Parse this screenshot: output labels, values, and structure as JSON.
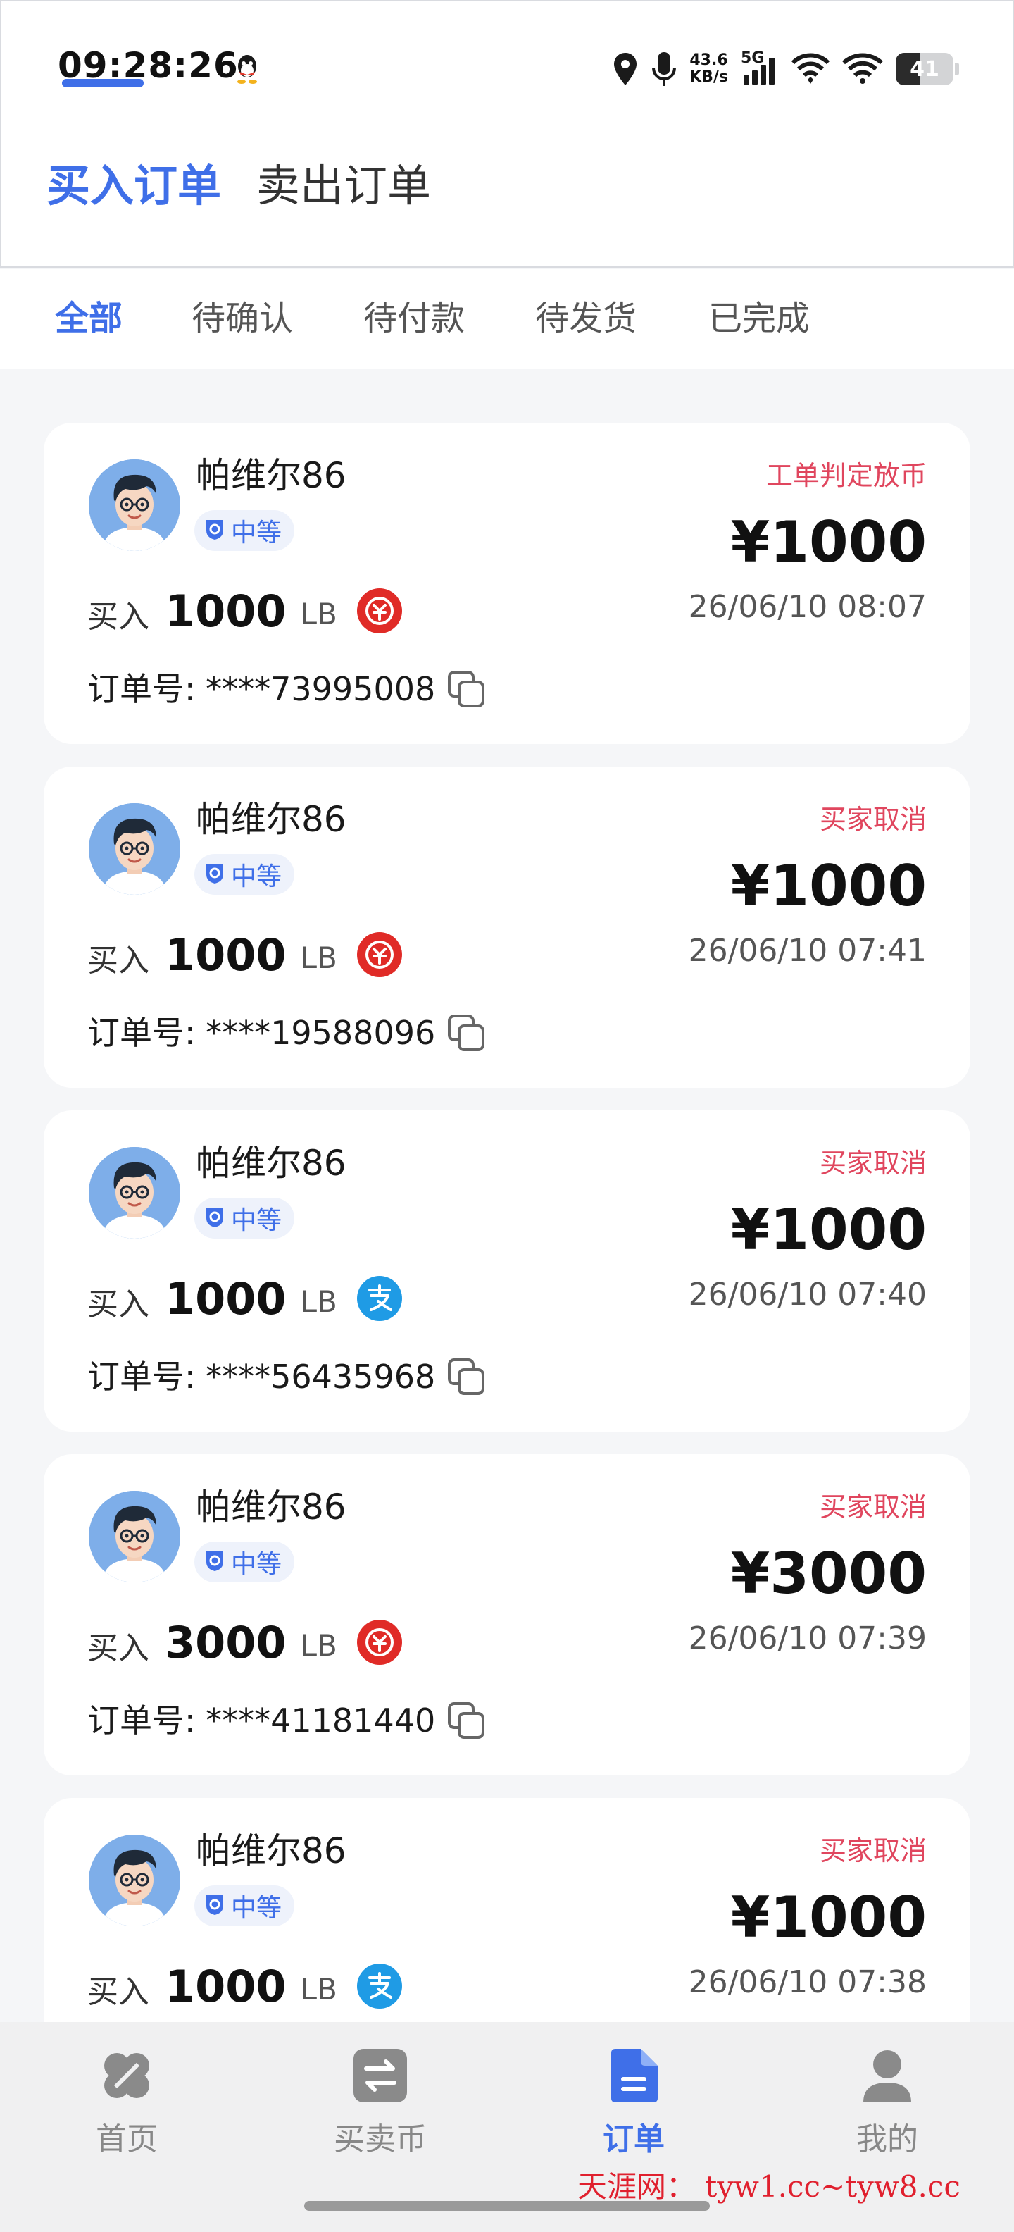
{
  "status_bar": {
    "time": "09:28:26",
    "net_speed_value": "43.6",
    "net_speed_unit": "KB/s",
    "network_type": "5G",
    "battery_level": 41,
    "icons": [
      "qq-icon",
      "location-icon",
      "microphone-icon",
      "cell-signal-icon",
      "wifi-icon",
      "wifi-icon",
      "battery-icon"
    ]
  },
  "main_tabs": [
    {
      "label": "买入订单",
      "active": true
    },
    {
      "label": "卖出订单",
      "active": false
    }
  ],
  "filter_tabs": [
    {
      "label": "全部",
      "active": true
    },
    {
      "label": "待确认",
      "active": false
    },
    {
      "label": "待付款",
      "active": false
    },
    {
      "label": "待发货",
      "active": false
    },
    {
      "label": "已完成",
      "active": false
    }
  ],
  "orders": [
    {
      "username": "帕维尔86",
      "level": "中等",
      "status": "工单判定放币",
      "price": "¥1000",
      "buy_label": "买入",
      "amount": "1000",
      "unit": "LB",
      "payment": "digital-rmb-icon",
      "date": "26/06/10 08:07",
      "order_label": "订单号: ****73995008"
    },
    {
      "username": "帕维尔86",
      "level": "中等",
      "status": "买家取消",
      "price": "¥1000",
      "buy_label": "买入",
      "amount": "1000",
      "unit": "LB",
      "payment": "digital-rmb-icon",
      "date": "26/06/10 07:41",
      "order_label": "订单号: ****19588096"
    },
    {
      "username": "帕维尔86",
      "level": "中等",
      "status": "买家取消",
      "price": "¥1000",
      "buy_label": "买入",
      "amount": "1000",
      "unit": "LB",
      "payment": "alipay-icon",
      "date": "26/06/10 07:40",
      "order_label": "订单号: ****56435968"
    },
    {
      "username": "帕维尔86",
      "level": "中等",
      "status": "买家取消",
      "price": "¥3000",
      "buy_label": "买入",
      "amount": "3000",
      "unit": "LB",
      "payment": "digital-rmb-icon",
      "date": "26/06/10 07:39",
      "order_label": "订单号: ****41181440"
    },
    {
      "username": "帕维尔86",
      "level": "中等",
      "status": "买家取消",
      "price": "¥1000",
      "buy_label": "买入",
      "amount": "1000",
      "unit": "LB",
      "payment": "alipay-icon",
      "date": "26/06/10 07:38",
      "order_label": ""
    }
  ],
  "bottom_nav": [
    {
      "label": "首页",
      "icon": "home-icon",
      "active": false
    },
    {
      "label": "买卖币",
      "icon": "exchange-icon",
      "active": false
    },
    {
      "label": "订单",
      "icon": "order-document-icon",
      "active": true
    },
    {
      "label": "我的",
      "icon": "profile-icon",
      "active": false
    }
  ],
  "watermark": "天涯网： tyw1.cc~tyw8.cc",
  "colors": {
    "accent": "#3f6fe8",
    "status_red": "#e0465e",
    "digital_rmb_red": "#e02b27",
    "alipay_blue": "#1f9be5",
    "background": "#f5f6f8"
  }
}
